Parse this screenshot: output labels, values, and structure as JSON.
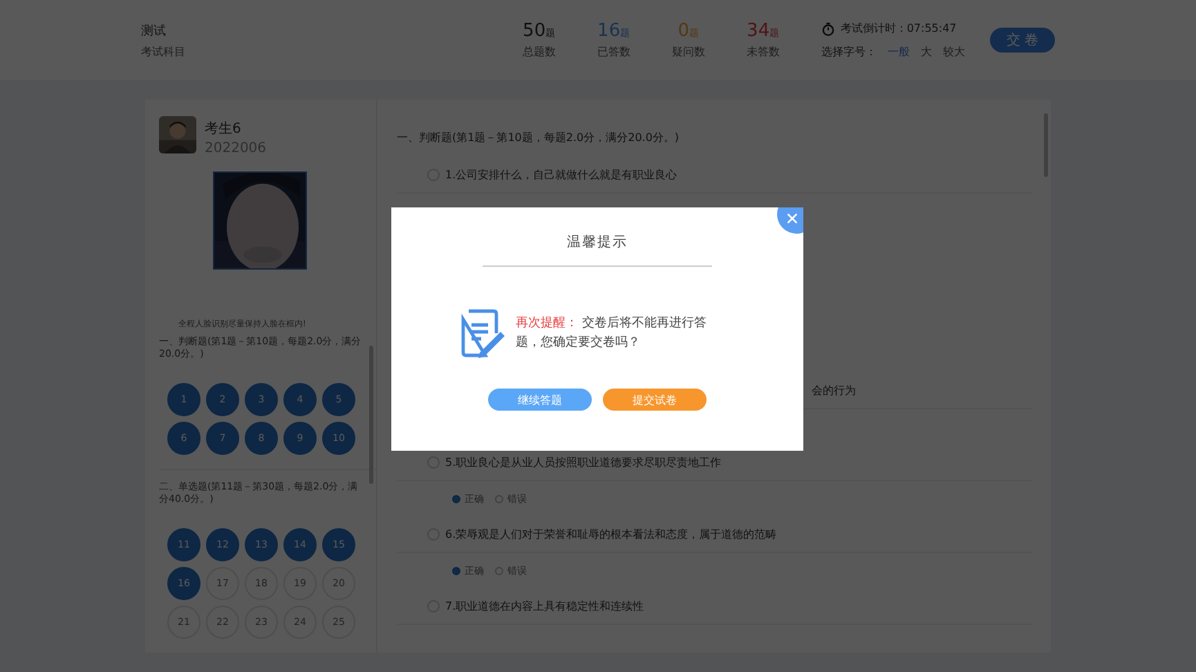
{
  "header": {
    "title": "测试",
    "subtitle": "考试科目",
    "stats": [
      {
        "value": "50",
        "unit": "题",
        "label": "总题数",
        "kind": "total"
      },
      {
        "value": "16",
        "unit": "题",
        "label": "已答数",
        "kind": "answered"
      },
      {
        "value": "0",
        "unit": "题",
        "label": "疑问数",
        "kind": "doubt"
      },
      {
        "value": "34",
        "unit": "题",
        "label": "未答数",
        "kind": "unanswered"
      }
    ],
    "timer": "考试倒计时：07:55:47",
    "font_label": "选择字号：",
    "font_sizes": [
      {
        "label": "一般",
        "selected": true
      },
      {
        "label": "大",
        "selected": false
      },
      {
        "label": "较大",
        "selected": false
      }
    ],
    "submit": "交 卷"
  },
  "candidate": {
    "name": "考生6",
    "id": "2022006",
    "face_caption": "全程人脸识别尽量保持人脸在框内!"
  },
  "nav_sections": [
    {
      "title": "一、判断题(第1题－第10题，每题2.0分，满分20.0分。)",
      "numbers": [
        {
          "label": "1",
          "answered": true
        },
        {
          "label": "2",
          "answered": true
        },
        {
          "label": "3",
          "answered": true
        },
        {
          "label": "4",
          "answered": true
        },
        {
          "label": "5",
          "answered": true
        },
        {
          "label": "6",
          "answered": true
        },
        {
          "label": "7",
          "answered": true
        },
        {
          "label": "8",
          "answered": true
        },
        {
          "label": "9",
          "answered": true
        },
        {
          "label": "10",
          "answered": true
        }
      ]
    },
    {
      "title": "二、单选题(第11题－第30题，每题2.0分，满分40.0分。)",
      "numbers": [
        {
          "label": "11",
          "answered": true
        },
        {
          "label": "12",
          "answered": true
        },
        {
          "label": "13",
          "answered": true
        },
        {
          "label": "14",
          "answered": true
        },
        {
          "label": "15",
          "answered": true
        },
        {
          "label": "16",
          "answered": true
        },
        {
          "label": "17",
          "answered": false
        },
        {
          "label": "18",
          "answered": false
        },
        {
          "label": "19",
          "answered": false
        },
        {
          "label": "20",
          "answered": false
        },
        {
          "label": "21",
          "answered": false
        },
        {
          "label": "22",
          "answered": false
        },
        {
          "label": "23",
          "answered": false
        },
        {
          "label": "24",
          "answered": false
        },
        {
          "label": "25",
          "answered": false
        }
      ]
    }
  ],
  "section_title": "一、判断题(第1题－第10题，每题2.0分，满分20.0分。)",
  "questions": [
    {
      "kind": "full",
      "text": "1.公司安排什么，自己就做什么就是有职业良心"
    },
    {
      "kind": "cut",
      "text": "会的行为"
    },
    {
      "kind": "full",
      "text": "5.职业良心是从业人员按照职业道德要求尽职尽责地工作",
      "options": [
        {
          "label": "正确",
          "selected": true
        },
        {
          "label": "错误",
          "selected": false
        }
      ]
    },
    {
      "kind": "full",
      "text": "6.荣辱观是人们对于荣誉和耻辱的根本看法和态度，属于道德的范畴",
      "options": [
        {
          "label": "正确",
          "selected": true
        },
        {
          "label": "错误",
          "selected": false
        }
      ]
    },
    {
      "kind": "full",
      "text": "7.职业道德在内容上具有稳定性和连续性"
    }
  ],
  "dialog": {
    "title": "温馨提示",
    "emphasis": "再次提醒：",
    "message": "交卷后将不能再进行答题，您确定要交卷吗？",
    "buttons": [
      {
        "kind": "secondary",
        "label": "继续答题"
      },
      {
        "kind": "primary",
        "label": "提交试卷"
      }
    ]
  }
}
